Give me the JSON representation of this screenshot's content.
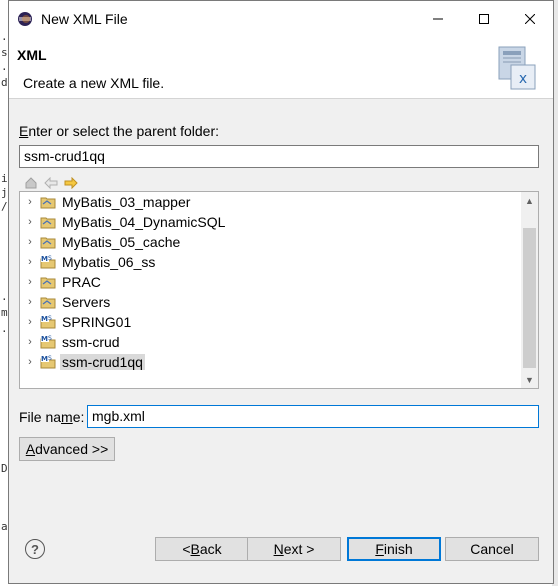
{
  "window": {
    "title": "New XML File",
    "minimize": "—",
    "maximize": "☐",
    "close": "✕"
  },
  "header": {
    "title": "XML",
    "description": "Create a new XML file."
  },
  "parent_folder": {
    "label_prefix": "E",
    "label_rest": "nter or select the parent folder:",
    "value": "ssm-crud1qq"
  },
  "toolbar": {
    "home_icon": "home-icon",
    "back_icon": "back-arrow-icon",
    "forward_icon": "forward-arrow-icon"
  },
  "tree": {
    "items": [
      {
        "label": "MyBatis_03_mapper",
        "icon": "folder-project-icon",
        "selected": false
      },
      {
        "label": "MyBatis_04_DynamicSQL",
        "icon": "folder-project-icon",
        "selected": false
      },
      {
        "label": "MyBatis_05_cache",
        "icon": "folder-project-icon",
        "selected": false
      },
      {
        "label": "Mybatis_06_ss",
        "icon": "maven-project-icon",
        "selected": false
      },
      {
        "label": "PRAC",
        "icon": "folder-project-icon",
        "selected": false
      },
      {
        "label": "Servers",
        "icon": "folder-project-icon",
        "selected": false
      },
      {
        "label": "SPRING01",
        "icon": "maven-project-icon",
        "selected": false
      },
      {
        "label": "ssm-crud",
        "icon": "maven-project-icon",
        "selected": false
      },
      {
        "label": "ssm-crud1qq",
        "icon": "maven-project-icon",
        "selected": true
      }
    ]
  },
  "file_name": {
    "label_pre": "File na",
    "label_u": "m",
    "label_post": "e:",
    "value": "mgb.xml"
  },
  "advanced": {
    "label_u": "A",
    "label_rest": "dvanced >>"
  },
  "buttons": {
    "back_pre": "< ",
    "back_u": "B",
    "back_post": "ack",
    "next_u": "N",
    "next_post": "ext >",
    "finish_u": "F",
    "finish_post": "inish",
    "cancel": "Cancel"
  },
  "help": {
    "symbol": "?"
  }
}
